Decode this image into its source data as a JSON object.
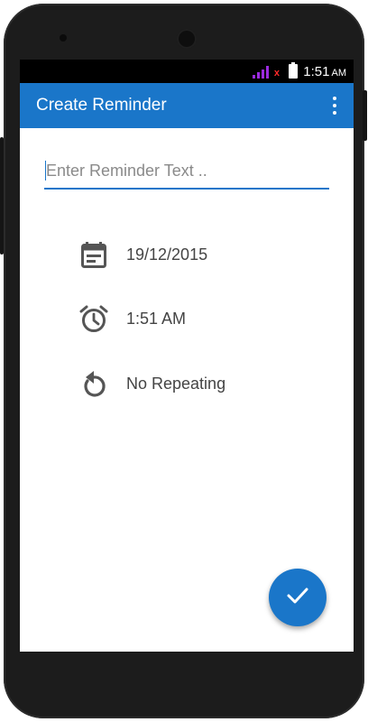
{
  "colors": {
    "accent": "#1a76c9",
    "statusbar": "#000000",
    "signal": "#9b2be0",
    "signal_x": "#ff2a2a"
  },
  "status": {
    "time": "1:51",
    "ampm": "AM",
    "signal_icon": "signal-icon",
    "battery_icon": "battery-icon"
  },
  "appbar": {
    "title": "Create Reminder",
    "menu_icon": "overflow-menu-icon"
  },
  "form": {
    "reminder_placeholder": "Enter Reminder Text ..",
    "reminder_value": ""
  },
  "settings": {
    "date": {
      "icon": "calendar-icon",
      "value": "19/12/2015"
    },
    "time": {
      "icon": "alarm-clock-icon",
      "value": "1:51 AM"
    },
    "repeat": {
      "icon": "repeat-icon",
      "value": "No Repeating"
    }
  },
  "fab": {
    "icon": "check-icon"
  }
}
